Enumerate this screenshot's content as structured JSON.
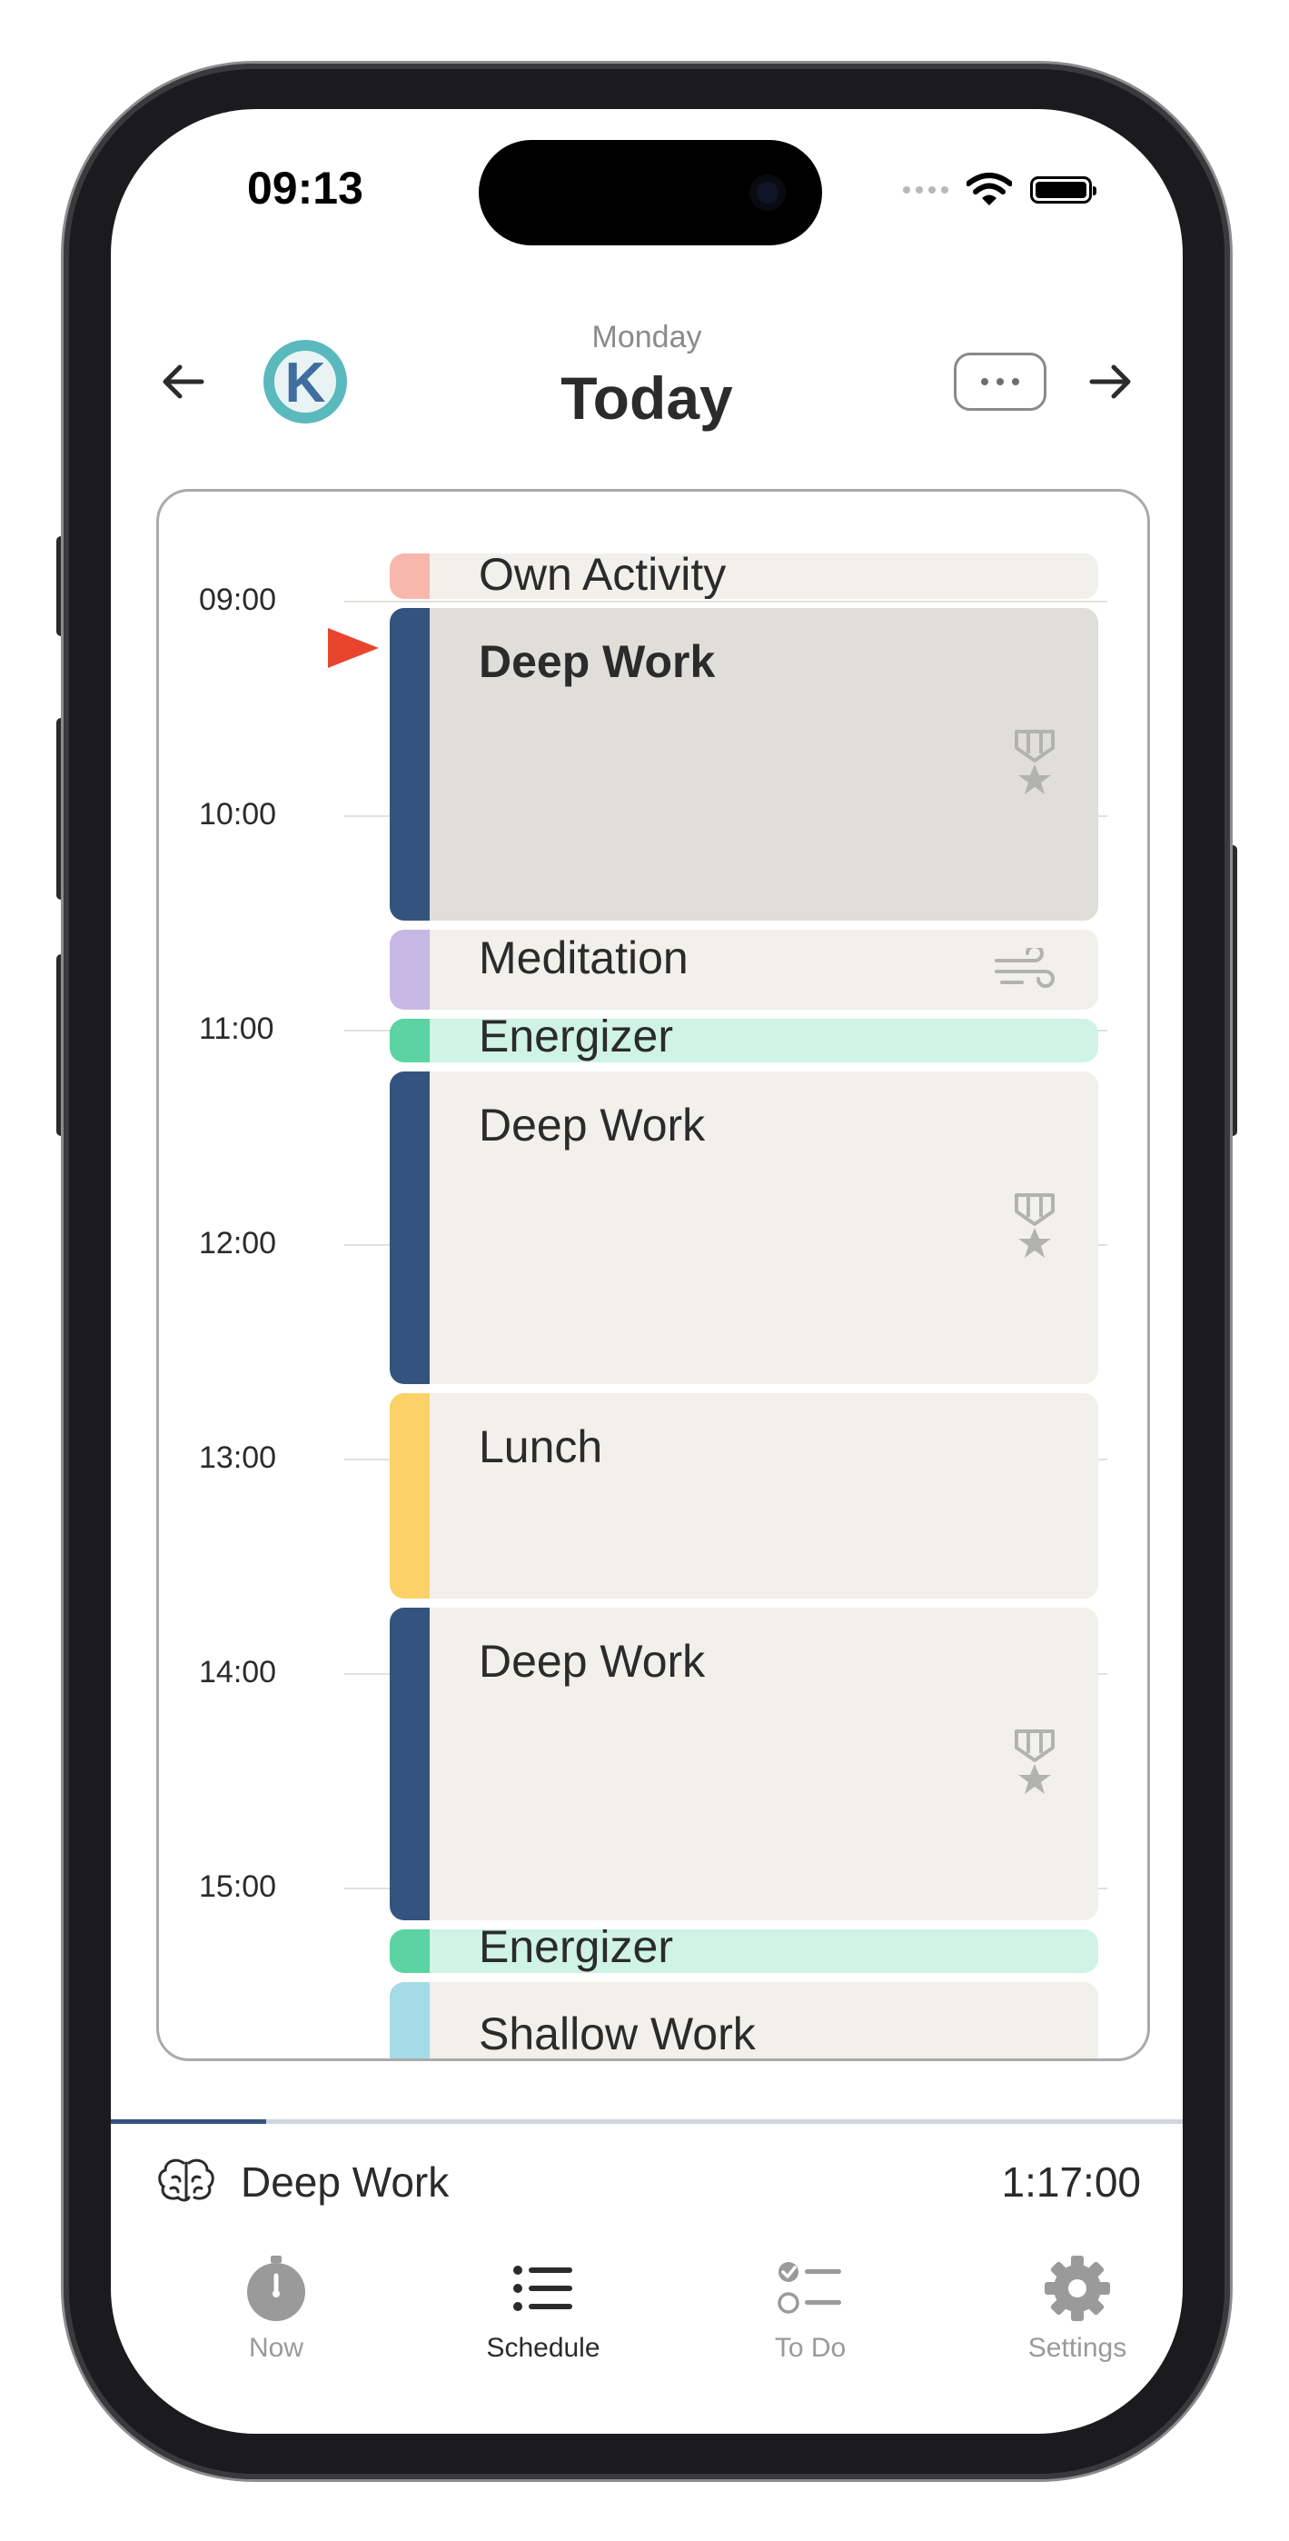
{
  "status_bar": {
    "time": "09:13"
  },
  "header": {
    "day": "Monday",
    "title": "Today",
    "avatar_letter": "K"
  },
  "schedule": {
    "hours": [
      "09:00",
      "10:00",
      "11:00",
      "12:00",
      "13:00",
      "14:00",
      "15:00"
    ],
    "events": [
      {
        "label": "Own Activity",
        "color": "#f8b7ad",
        "bold": false,
        "icon": ""
      },
      {
        "label": "Deep Work",
        "color": "#34547f",
        "bold": true,
        "icon": "medal-star-icon",
        "current": true
      },
      {
        "label": "Meditation",
        "color": "#c8b8e6",
        "bold": false,
        "icon": "wind-icon"
      },
      {
        "label": "Energizer",
        "color": "#5bd3a3",
        "bold": false,
        "icon": ""
      },
      {
        "label": "Deep Work",
        "color": "#34547f",
        "bold": false,
        "icon": "medal-star-icon"
      },
      {
        "label": "Lunch",
        "color": "#fbd168",
        "bold": false,
        "icon": ""
      },
      {
        "label": "Deep Work",
        "color": "#34547f",
        "bold": false,
        "icon": "medal-star-icon"
      },
      {
        "label": "Energizer",
        "color": "#5bd3a3",
        "bold": false,
        "icon": ""
      },
      {
        "label": "Shallow Work",
        "color": "#a3dbe6",
        "bold": false,
        "icon": ""
      }
    ]
  },
  "now_playing": {
    "label": "Deep Work",
    "time": "1:17:00",
    "progress": 0.145
  },
  "tabs": [
    {
      "label": "Now",
      "icon": "stopwatch-icon",
      "active": false
    },
    {
      "label": "Schedule",
      "icon": "list-icon",
      "active": true
    },
    {
      "label": "To Do",
      "icon": "checklist-icon",
      "active": false
    },
    {
      "label": "Settings",
      "icon": "gear-icon",
      "active": false
    }
  ],
  "colors": {
    "accent": "#34547f",
    "now_marker": "#e8452c",
    "event_bg": "#f1f0ea",
    "current_event_bg": "#dfded9"
  }
}
